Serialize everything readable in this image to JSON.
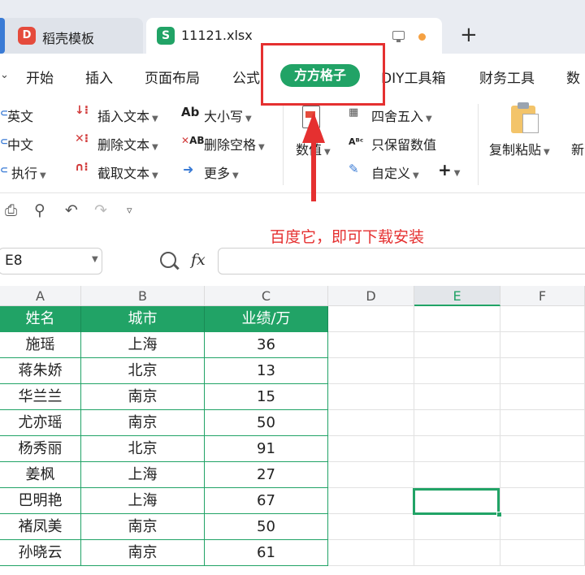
{
  "tabs": [
    {
      "label": "稻壳模板",
      "icon": "daoke-logo-icon"
    },
    {
      "label": "11121.xlsx",
      "icon": "spreadsheet-file-icon"
    }
  ],
  "tab_add": "+",
  "menu": {
    "items": [
      "开始",
      "插入",
      "页面布局",
      "公式",
      "方方格子",
      "DIY工具箱",
      "财务工具",
      "数"
    ],
    "active": "方方格子"
  },
  "ribbon": {
    "col1": [
      {
        "label": "英文",
        "dropdown": false
      },
      {
        "label": "中文",
        "dropdown": false
      },
      {
        "label": "执行",
        "dropdown": true
      }
    ],
    "col2": [
      {
        "label": "插入文本",
        "dropdown": true
      },
      {
        "label": "删除文本",
        "dropdown": true
      },
      {
        "label": "截取文本",
        "dropdown": true
      }
    ],
    "col3": [
      {
        "label": "大小写",
        "dropdown": true
      },
      {
        "label": "删除空格",
        "dropdown": true
      },
      {
        "label": "更多",
        "dropdown": true
      }
    ],
    "numeric_label": "数值",
    "col5": [
      {
        "label": "四舍五入",
        "dropdown": true
      },
      {
        "label": "只保留数值",
        "dropdown": false
      },
      {
        "label": "自定义",
        "dropdown": true
      }
    ],
    "plus": "+",
    "copy_paste": "复制粘贴",
    "new_partial": "新"
  },
  "annotation": {
    "text": "百度它，即可下载安装",
    "color": "#e53030"
  },
  "formula_bar": {
    "name_box": "E8",
    "fx": "fx",
    "value": ""
  },
  "grid": {
    "columns": [
      "A",
      "B",
      "C",
      "D",
      "E",
      "F"
    ],
    "active_column": "E",
    "header_row": [
      "姓名",
      "城市",
      "业绩/万"
    ],
    "rows": [
      [
        "施瑶",
        "上海",
        "36"
      ],
      [
        "蒋朱娇",
        "北京",
        "13"
      ],
      [
        "华兰兰",
        "南京",
        "15"
      ],
      [
        "尤亦瑶",
        "南京",
        "50"
      ],
      [
        "杨秀丽",
        "北京",
        "91"
      ],
      [
        "姜枫",
        "上海",
        "27"
      ],
      [
        "巴明艳",
        "上海",
        "67"
      ],
      [
        "褚凤美",
        "南京",
        "50"
      ],
      [
        "孙晓云",
        "南京",
        "61"
      ]
    ],
    "selected_cell": "E8"
  },
  "colors": {
    "accent": "#21a366",
    "annotation": "#e53030"
  }
}
